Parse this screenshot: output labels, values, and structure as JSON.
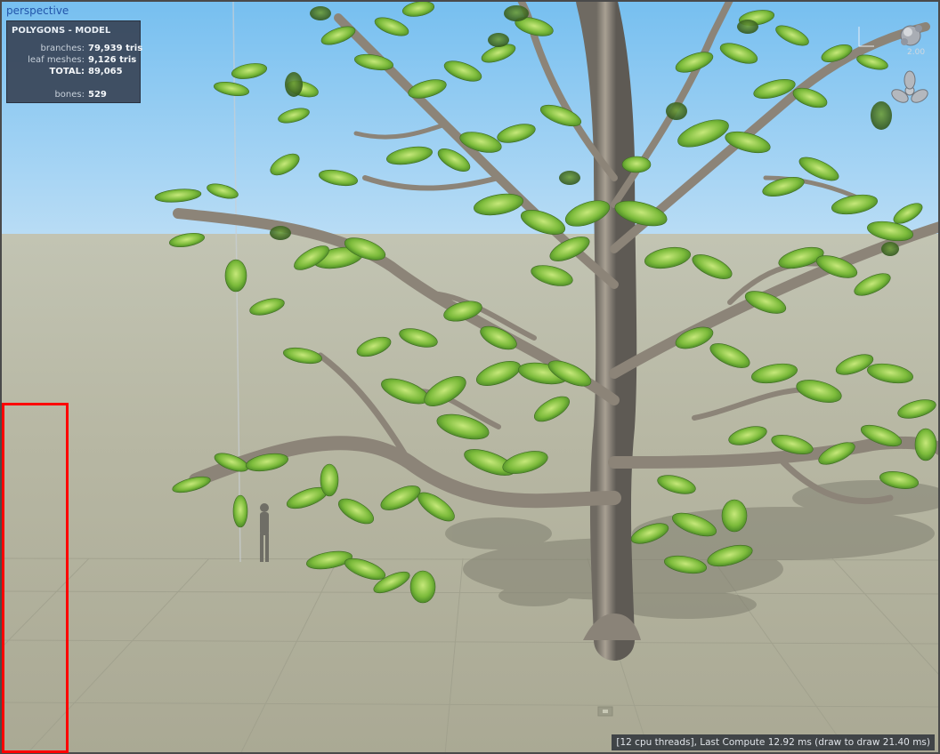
{
  "viewport": {
    "label": "perspective"
  },
  "stats_panel": {
    "title": "POLYGONS - MODEL",
    "branches_label": "branches:",
    "branches_value": "79,939 tris",
    "leaf_meshes_label": "leaf meshes:",
    "leaf_meshes_value": "9,126 tris",
    "total_label": "TOTAL:",
    "total_value": "89,065",
    "bones_label": "bones:",
    "bones_value": "529"
  },
  "gizmo": {
    "zoom_value": "2.00",
    "icons": [
      "view-sphere-icon",
      "wind-fan-icon"
    ]
  },
  "status": {
    "perf_text": "[12 cpu threads], Last Compute 12.92 ms (draw to draw 21.40 ms)"
  },
  "colors": {
    "sky_top": "#7ec3f2",
    "sky_bottom": "#b5dbf5",
    "ground": "#b6b6a2",
    "highlight": "#ff0000",
    "leaf": "#7fbf3c",
    "bark": "#8c8478"
  },
  "scene_objects": [
    "tree",
    "human-scale-figure",
    "ground-grid",
    "tree-shadow"
  ]
}
